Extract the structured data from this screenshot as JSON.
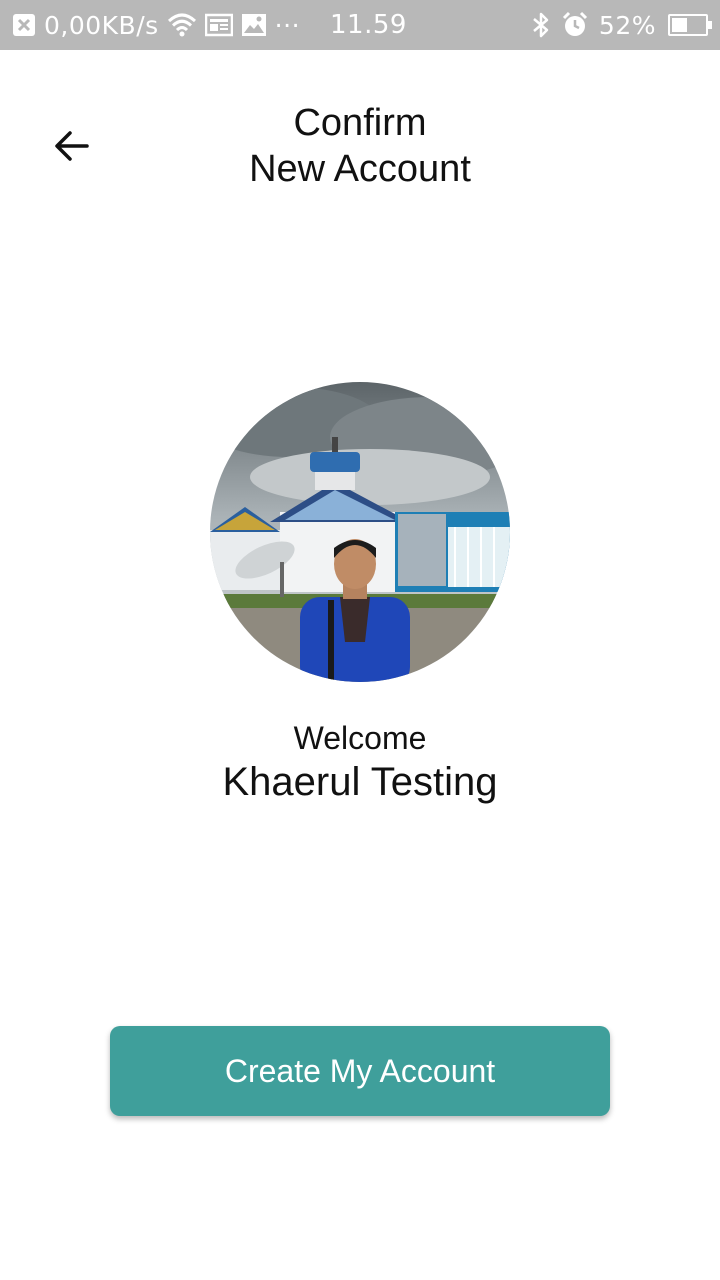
{
  "status_bar": {
    "network_speed": "0,00KB/s",
    "dots": "···",
    "time": "11.59",
    "battery_percent": "52%",
    "battery_level": 0.52,
    "icons": [
      "close-box-icon",
      "wifi-icon",
      "news-icon",
      "image-icon",
      "bluetooth-icon",
      "alarm-icon",
      "battery-icon"
    ]
  },
  "header": {
    "back_icon": "arrow-left-icon",
    "title_line1": "Confirm",
    "title_line2": "New Account"
  },
  "profile": {
    "welcome_text": "Welcome",
    "name": "Khaerul Testing"
  },
  "actions": {
    "create_label": "Create My Account"
  },
  "colors": {
    "accent": "#3f9f9b",
    "status_bar": "#b8b8b8"
  }
}
